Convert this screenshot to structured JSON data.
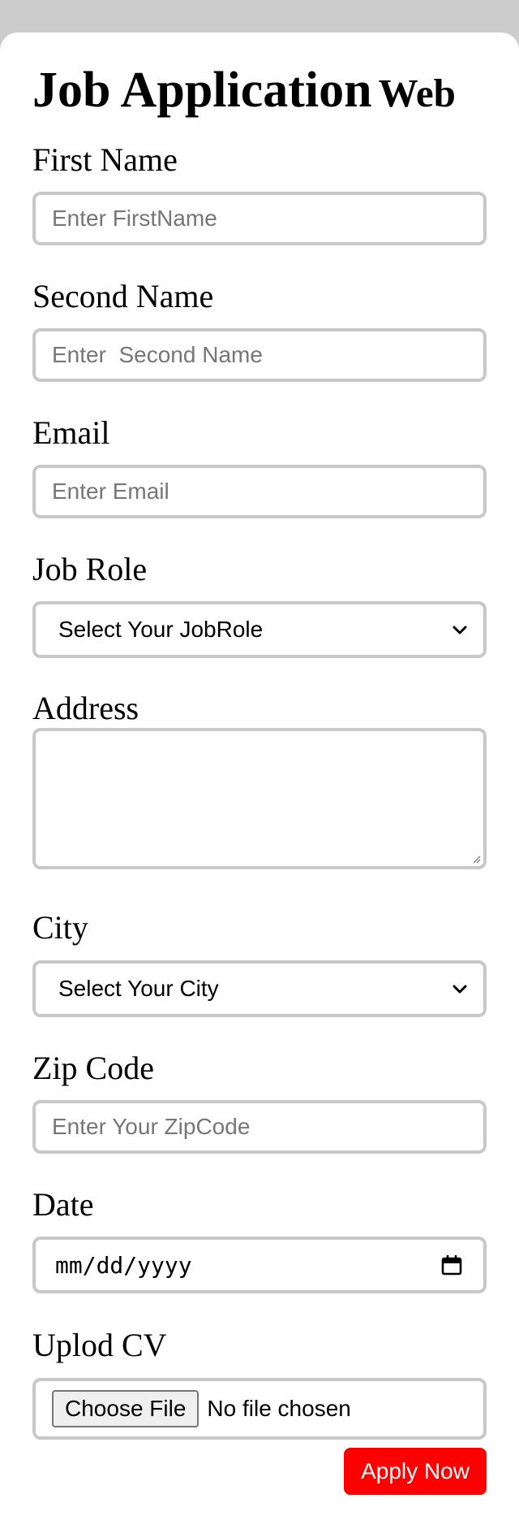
{
  "form": {
    "title": "Job Application",
    "title_suffix": "Web",
    "first_name": {
      "label": "First Name",
      "placeholder": "Enter FirstName",
      "value": ""
    },
    "second_name": {
      "label": "Second Name",
      "placeholder": "Enter  Second Name",
      "value": ""
    },
    "email": {
      "label": "Email",
      "placeholder": "Enter Email",
      "value": ""
    },
    "job_role": {
      "label": "Job Role",
      "selected": "Select Your JobRole",
      "icon": "chevron-down-icon"
    },
    "address": {
      "label": "Address",
      "value": ""
    },
    "city": {
      "label": "City",
      "selected": "Select Your City",
      "icon": "chevron-down-icon"
    },
    "zip_code": {
      "label": "Zip Code",
      "placeholder": "Enter Your ZipCode",
      "value": ""
    },
    "date": {
      "label": "Date",
      "placeholder": "mm/dd/yyyy",
      "icon": "calendar-icon"
    },
    "cv": {
      "label": "Uplod CV",
      "button": "Choose File",
      "status": "No file chosen"
    },
    "submit": {
      "label": "Apply Now",
      "color": "#ff0000"
    }
  },
  "colors": {
    "page_background": "#cccccc",
    "card_background": "#ffffff",
    "field_border": "#c8c8c8",
    "placeholder": "#767676",
    "button_text": "#ffffff"
  }
}
